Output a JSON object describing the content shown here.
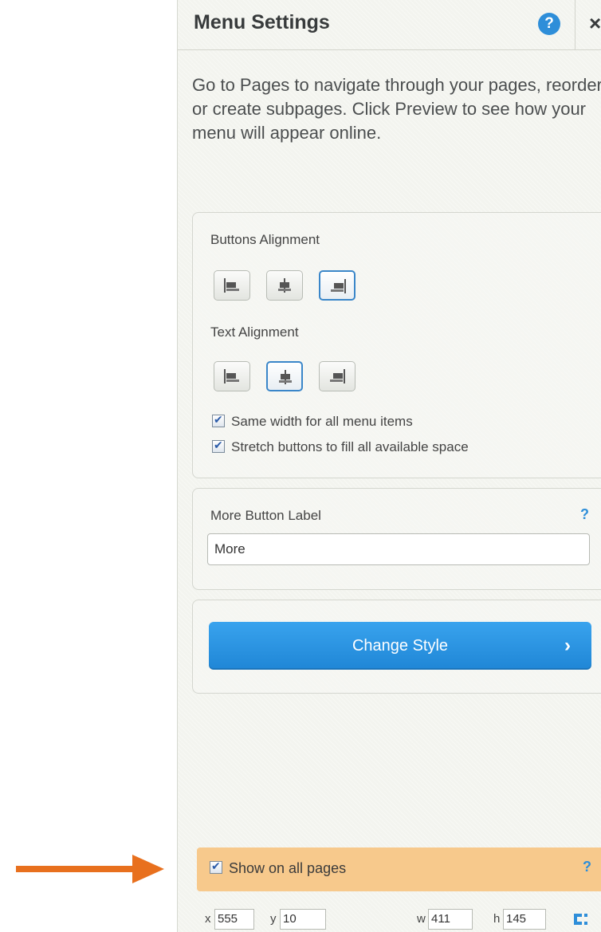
{
  "panel": {
    "title": "Menu Settings",
    "help_icon": "?",
    "close_icon": "×",
    "intro": "Go to Pages to navigate through your pages, reorder or create subpages. Click Preview to see how your menu will appear online."
  },
  "alignment": {
    "buttons_label": "Buttons Alignment",
    "buttons_selected": "right",
    "text_label": "Text Alignment",
    "text_selected": "center",
    "options": [
      "left",
      "center",
      "right"
    ]
  },
  "checkboxes": {
    "same_width": {
      "label": "Same width for all menu items",
      "checked": true
    },
    "stretch": {
      "label": "Stretch buttons to fill all available space",
      "checked": true
    }
  },
  "more_button": {
    "label": "More Button Label",
    "help": "?",
    "value": "More"
  },
  "change_style": {
    "label": "Change Style",
    "chevron": "›"
  },
  "show_all_pages": {
    "label": "Show on all pages",
    "checked": true,
    "help": "?"
  },
  "coords": {
    "x_label": "x",
    "x": "555",
    "y_label": "y",
    "y": "10",
    "w_label": "w",
    "w": "411",
    "h_label": "h",
    "h": "145"
  },
  "colors": {
    "accent_blue": "#2e8ed9",
    "highlight_orange": "#f7c98c",
    "arrow_orange": "#e8701e"
  },
  "icons": {
    "help": "question-circle-icon",
    "close": "close-icon",
    "lock": "proportion-lock-icon",
    "arrow": "orange-arrow-icon"
  }
}
